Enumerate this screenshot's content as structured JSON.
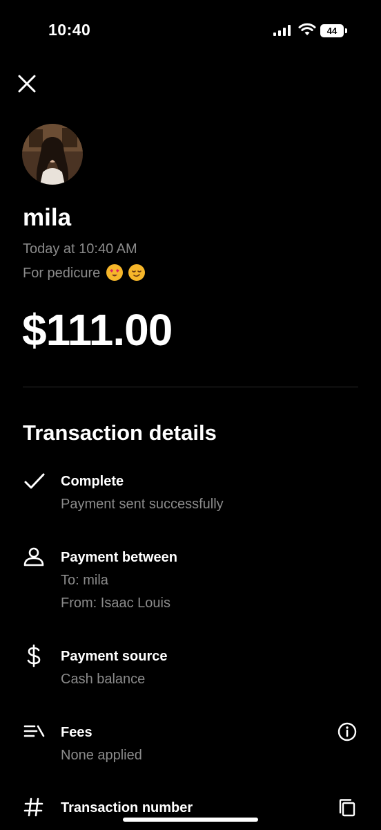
{
  "status_bar": {
    "time": "10:40",
    "battery": "44"
  },
  "header": {
    "close_icon": "close-icon"
  },
  "recipient": {
    "name": "mila",
    "timestamp": "Today at 10:40 AM",
    "note": "For pedicure"
  },
  "amount": "$111.00",
  "details": {
    "title": "Transaction details",
    "status_title": "Complete",
    "status_sub": "Payment sent successfully",
    "between_title": "Payment between",
    "between_to": "To: mila",
    "between_from": "From: Isaac Louis",
    "source_title": "Payment source",
    "source_sub": "Cash balance",
    "fees_title": "Fees",
    "fees_sub": "None applied",
    "txn_title": "Transaction number"
  },
  "colors": {
    "background": "#000000",
    "text": "#ffffff",
    "muted": "#8b8b8b",
    "divider": "#2c2c2c"
  }
}
